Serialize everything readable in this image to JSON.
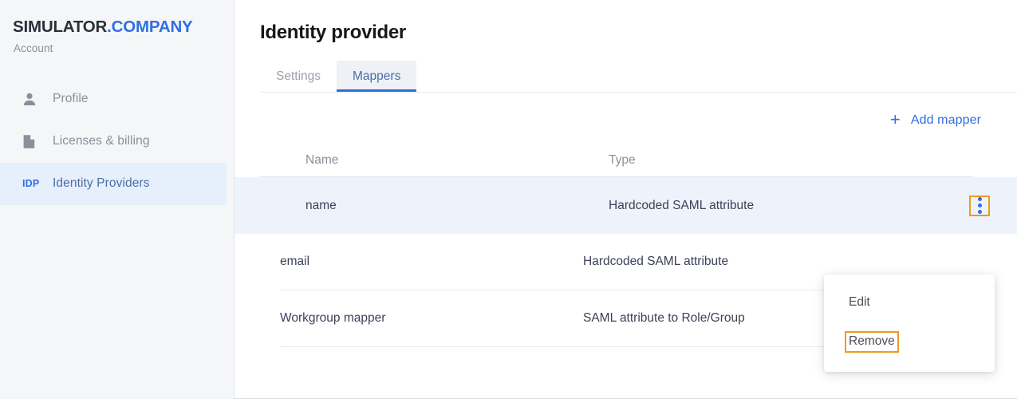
{
  "sidebar": {
    "brand": {
      "main": "SIMULATOR",
      "accent": ".COMPANY",
      "subtitle": "Account"
    },
    "items": [
      {
        "label": "Profile",
        "icon": "user-icon",
        "active": false
      },
      {
        "label": "Licenses & billing",
        "icon": "document-icon",
        "active": false
      },
      {
        "label": "Identity Providers",
        "icon": "idp-badge",
        "badge": "IDP",
        "active": true
      }
    ]
  },
  "main": {
    "title": "Identity provider",
    "tabs": [
      {
        "label": "Settings",
        "active": false
      },
      {
        "label": "Mappers",
        "active": true
      }
    ],
    "toolbar": {
      "add_mapper_label": "Add mapper",
      "plus_icon": "+"
    },
    "table": {
      "columns": [
        "Name",
        "Type"
      ],
      "rows": [
        {
          "name": "name",
          "type": "Hardcoded SAML attribute",
          "selected": true
        },
        {
          "name": "email",
          "type": "Hardcoded SAML attribute",
          "selected": false
        },
        {
          "name": "Workgroup mapper",
          "type": "SAML attribute to Role/Group",
          "selected": false
        }
      ]
    },
    "row_menu": {
      "items": [
        {
          "label": "Edit",
          "focused": false
        },
        {
          "label": "Remove",
          "focused": true
        }
      ]
    }
  },
  "colors": {
    "accent_blue": "#2f6fe0",
    "focus_orange": "#eb9b20",
    "sidebar_bg": "#f5f6f8",
    "active_nav_bg": "#e6effc",
    "selected_row_bg": "#eef2fb"
  }
}
